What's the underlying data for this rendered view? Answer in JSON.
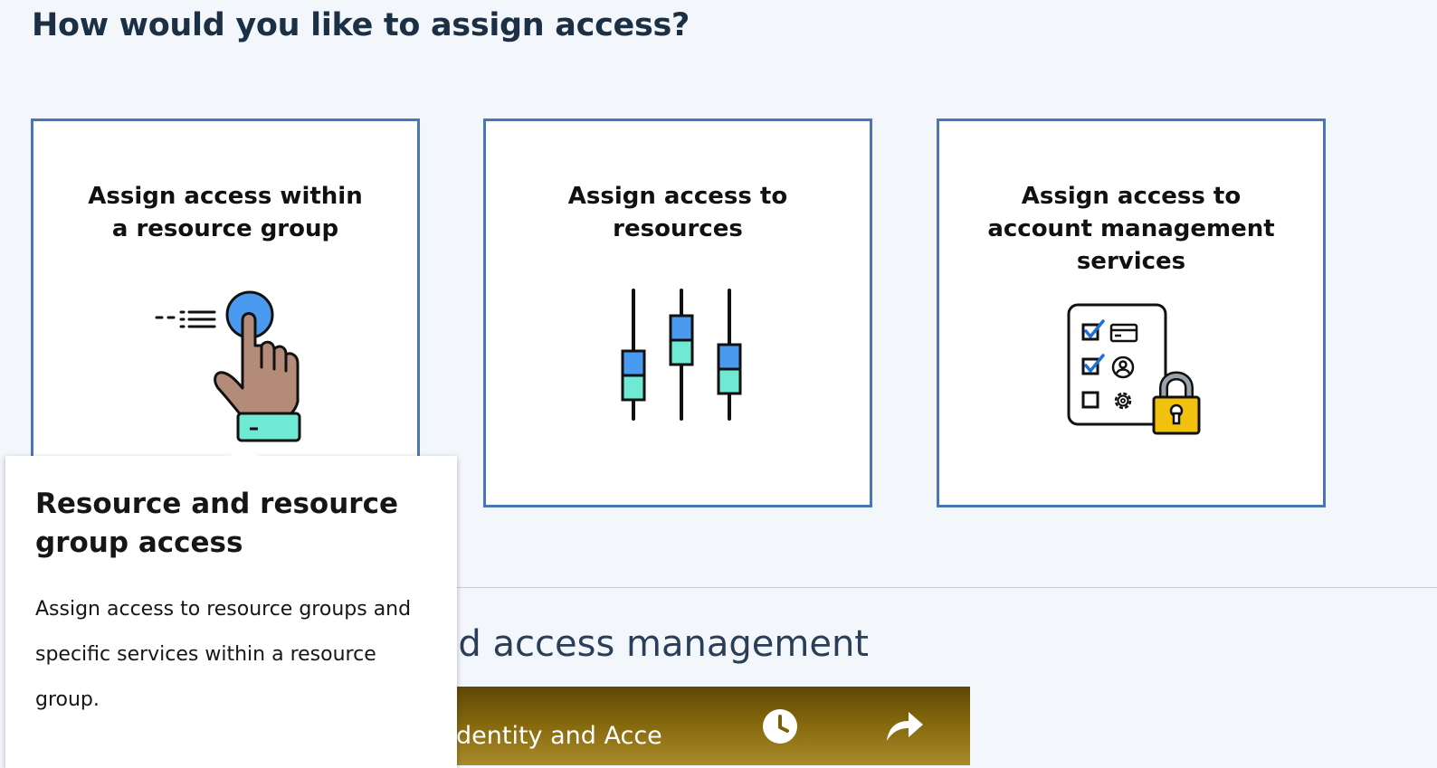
{
  "page": {
    "title": "How would you like to assign access?"
  },
  "cards": [
    {
      "title_line1": "Assign access within",
      "title_line2": "a resource group",
      "icon": "hand-click-icon"
    },
    {
      "title_line1": "Assign access to",
      "title_line2": "resources",
      "icon": "sliders-icon"
    },
    {
      "title_line1": "Assign access to",
      "title_line2": "account management",
      "title_line3": "services",
      "icon": "checklist-lock-icon"
    }
  ],
  "popover": {
    "title": "Resource and resource group access",
    "body": "Assign access to resource groups and specific services within a resource group."
  },
  "section": {
    "heading_visible": "oud access management"
  },
  "video": {
    "title_visible": "dentity and Acce",
    "icons": [
      "clock-icon",
      "share-icon"
    ]
  },
  "colors": {
    "card_border": "#4a76b9",
    "page_bg": "#f3f6fb",
    "heading": "#1b2f45",
    "icon_blue": "#4a9bef",
    "icon_teal": "#6fe8d4",
    "icon_skin": "#b48a78",
    "lock_gold": "#f2c10e"
  }
}
